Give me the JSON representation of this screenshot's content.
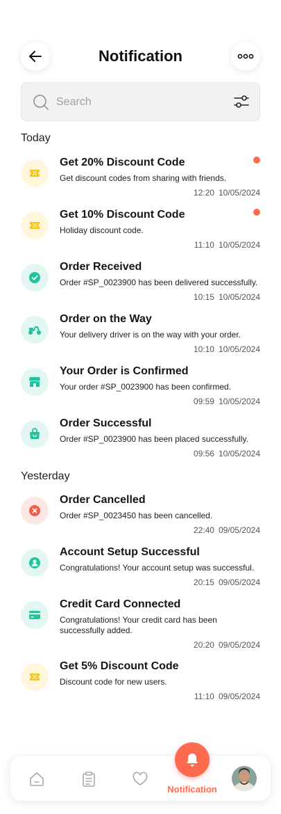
{
  "header": {
    "title": "Notification",
    "back_icon": "arrow-left-icon",
    "more_icon": "more-horizontal-icon"
  },
  "search": {
    "placeholder": "Search",
    "value": ""
  },
  "sections": [
    {
      "label": "Today"
    },
    {
      "label": "Yesterday"
    }
  ],
  "notifications": [
    {
      "icon": "discount-ticket-icon",
      "title": "Get 20% Discount Code",
      "desc": "Get discount codes from sharing with friends.",
      "time": "12:20",
      "date": "10/05/2024",
      "unread": true
    },
    {
      "icon": "discount-ticket-icon",
      "title": "Get 10% Discount Code",
      "desc": "Holiday discount code.",
      "time": "11:10",
      "date": "10/05/2024",
      "unread": true
    },
    {
      "icon": "check-circle-icon",
      "title": "Order Received",
      "desc": "Order #SP_0023900 has been delivered successfully.",
      "time": "10:15",
      "date": "10/05/2024",
      "unread": false
    },
    {
      "icon": "scooter-icon",
      "title": "Order on the Way",
      "desc": "Your delivery driver is on the way with your order.",
      "time": "10:10",
      "date": "10/05/2024",
      "unread": false
    },
    {
      "icon": "store-icon",
      "title": "Your Order is Confirmed",
      "desc": "Your order #SP_0023900 has been confirmed.",
      "time": "09:59",
      "date": "10/05/2024",
      "unread": false
    },
    {
      "icon": "shopping-bag-icon",
      "title": "Order Successful",
      "desc": "Order #SP_0023900 has been placed successfully.",
      "time": "09:56",
      "date": "10/05/2024",
      "unread": false
    },
    {
      "icon": "cancel-circle-icon",
      "title": "Order Cancelled",
      "desc": "Order #SP_0023450 has been cancelled.",
      "time": "22:40",
      "date": "09/05/2024",
      "unread": false
    },
    {
      "icon": "user-circle-icon",
      "title": "Account Setup Successful",
      "desc": "Congratulations! Your account setup was successful.",
      "time": "20:15",
      "date": "09/05/2024",
      "unread": false
    },
    {
      "icon": "credit-card-icon",
      "title": "Credit Card Connected",
      "desc": "Congratulations! Your credit card has been successfully added.",
      "time": "20:20",
      "date": "09/05/2024",
      "unread": false
    },
    {
      "icon": "discount-ticket-icon",
      "title": "Get 5% Discount Code",
      "desc": "Discount code for new users.",
      "time": "11:10",
      "date": "09/05/2024",
      "unread": false
    }
  ],
  "bottom_nav": {
    "items": [
      {
        "icon": "home-icon"
      },
      {
        "icon": "clipboard-icon"
      },
      {
        "icon": "heart-icon"
      },
      {
        "icon": "bell-icon",
        "label": "Notification",
        "active": true
      },
      {
        "icon": "profile-avatar"
      }
    ]
  },
  "colors": {
    "accent": "#ff6b4f",
    "green": "#20c39b",
    "yellow": "#f5c518",
    "red": "#f25c4a"
  }
}
